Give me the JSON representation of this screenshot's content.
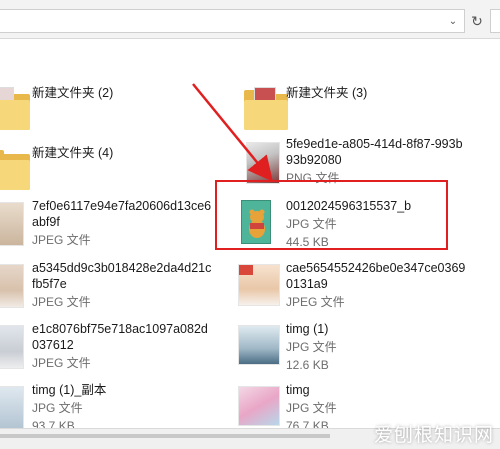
{
  "files": [
    {
      "name": "新建文件夹 (2)",
      "type": "",
      "size": "",
      "kind": "folder"
    },
    {
      "name": "新建文件夹 (3)",
      "type": "",
      "size": "",
      "kind": "folder"
    },
    {
      "name": "新建文件夹 (4)",
      "type": "",
      "size": "",
      "kind": "folder"
    },
    {
      "name": "5fe9ed1e-a805-414d-8f87-993b93b92080",
      "type": "PNG 文件",
      "size": "",
      "kind": "image"
    },
    {
      "name": "7ef0e6117e94e7fa20606d13ce6abf9f",
      "type": "JPEG 文件",
      "size": "",
      "kind": "image"
    },
    {
      "name": "0012024596315537_b",
      "type": "JPG 文件",
      "size": "44.5 KB",
      "kind": "image"
    },
    {
      "name": "a5345dd9c3b018428e2da4d21cfb5f7e",
      "type": "JPEG 文件",
      "size": "",
      "kind": "image"
    },
    {
      "name": "cae5654552426be0e347ce03690131a9",
      "type": "JPEG 文件",
      "size": "",
      "kind": "image"
    },
    {
      "name": "e1c8076bf75e718ac1097a082d037612",
      "type": "JPEG 文件",
      "size": "",
      "kind": "image"
    },
    {
      "name": "timg (1)",
      "type": "JPG 文件",
      "size": "12.6 KB",
      "kind": "image"
    },
    {
      "name": "timg (1)_副本",
      "type": "JPG 文件",
      "size": "93.7 KB",
      "kind": "image"
    },
    {
      "name": "timg",
      "type": "JPG 文件",
      "size": "76.7 KB",
      "kind": "image"
    }
  ],
  "watermark": "爱刨根知识网",
  "icons": {
    "dropdown": "chevron-down-icon",
    "refresh": "refresh-icon"
  },
  "colors": {
    "highlight": "#e02020",
    "arrow": "#e02020"
  }
}
